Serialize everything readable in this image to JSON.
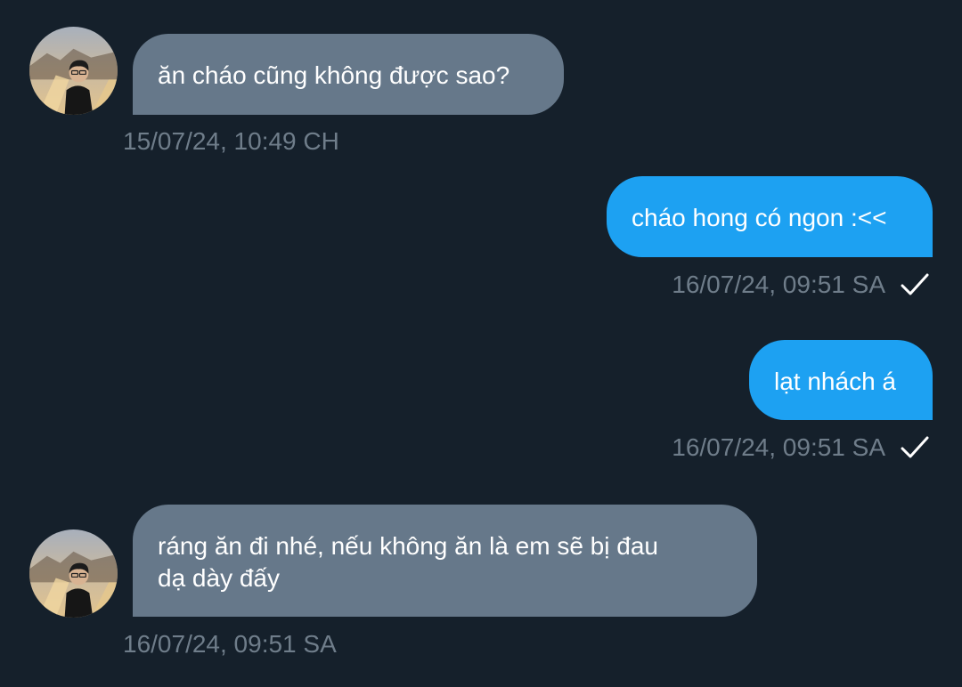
{
  "messages": [
    {
      "direction": "incoming",
      "text": "ăn cháo cũng không được sao?",
      "timestamp": "15/07/24, 10:49 CH"
    },
    {
      "direction": "outgoing",
      "text": "cháo hong có ngon :<<",
      "timestamp": "16/07/24, 09:51 SA",
      "status_icon": "check-icon"
    },
    {
      "direction": "outgoing",
      "text": "lạt nhách á",
      "timestamp": "16/07/24, 09:51 SA",
      "status_icon": "check-icon"
    },
    {
      "direction": "incoming",
      "text": "ráng ăn đi nhé, nếu không ăn là em sẽ bị đau\ndạ dày đấy",
      "timestamp": "16/07/24, 09:51 SA"
    }
  ],
  "colors": {
    "background": "#15202b",
    "incoming_bubble": "#66788a",
    "outgoing_bubble": "#1da1f2",
    "timestamp_text": "#6f7d8a"
  }
}
